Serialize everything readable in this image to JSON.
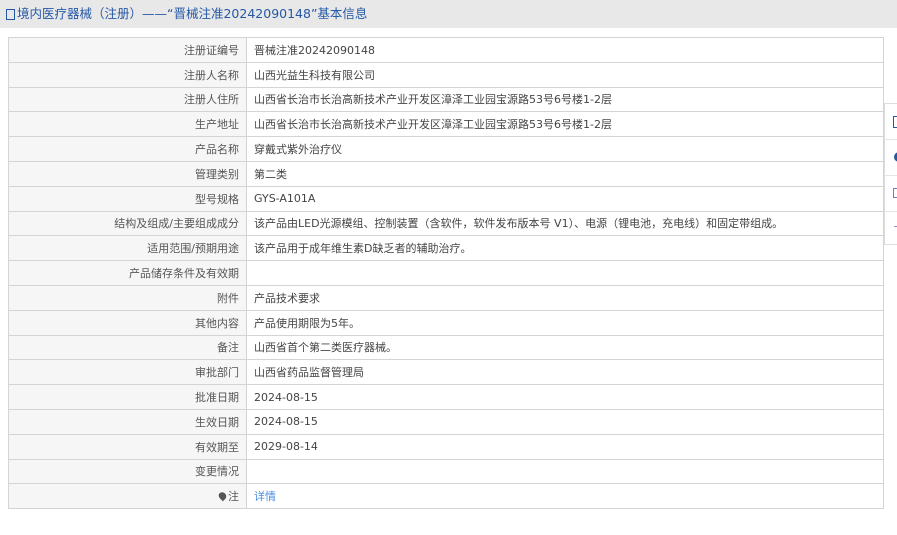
{
  "header": {
    "title": "境内医疗器械（注册）——“晋械注准20242090148”基本信息"
  },
  "rows": [
    {
      "label": "注册证编号",
      "value": "晋械注准20242090148"
    },
    {
      "label": "注册人名称",
      "value": "山西光益生科技有限公司"
    },
    {
      "label": "注册人住所",
      "value": "山西省长治市长治高新技术产业开发区漳泽工业园宝源路53号6号楼1-2层"
    },
    {
      "label": "生产地址",
      "value": "山西省长治市长治高新技术产业开发区漳泽工业园宝源路53号6号楼1-2层"
    },
    {
      "label": "产品名称",
      "value": "穿戴式紫外治疗仪"
    },
    {
      "label": "管理类别",
      "value": "第二类"
    },
    {
      "label": "型号规格",
      "value": "GYS-A101A"
    },
    {
      "label": "结构及组成/主要组成成分",
      "value": "该产品由LED光源模组、控制装置（含软件，软件发布版本号 V1）、电源（锂电池，充电线）和固定带组成。"
    },
    {
      "label": "适用范围/预期用途",
      "value": "该产品用于成年维生素D缺乏者的辅助治疗。"
    },
    {
      "label": "产品储存条件及有效期",
      "value": ""
    },
    {
      "label": "附件",
      "value": "产品技术要求"
    },
    {
      "label": "其他内容",
      "value": "产品使用期限为5年。"
    },
    {
      "label": "备注",
      "value": "山西省首个第二类医疗器械。"
    },
    {
      "label": "审批部门",
      "value": "山西省药品监督管理局"
    },
    {
      "label": "批准日期",
      "value": "2024-08-15"
    },
    {
      "label": "生效日期",
      "value": "2024-08-15"
    },
    {
      "label": "有效期至",
      "value": "2029-08-14"
    },
    {
      "label": "变更情况",
      "value": ""
    }
  ],
  "note": {
    "label": "注",
    "link": "详情"
  }
}
